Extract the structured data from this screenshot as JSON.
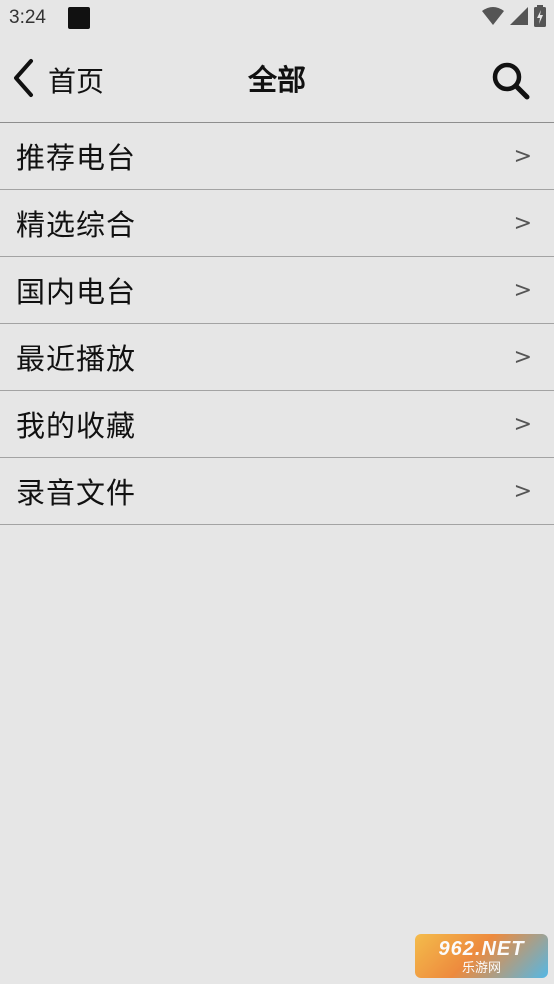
{
  "status_bar": {
    "time": "3:24",
    "icons": [
      "wifi-icon",
      "signal-icon",
      "battery-icon"
    ]
  },
  "nav": {
    "back_label": "首页",
    "title": "全部",
    "search_icon": "search-icon"
  },
  "menu": {
    "items": [
      {
        "label": "推荐电台",
        "arrow": ">"
      },
      {
        "label": "精选综合",
        "arrow": ">"
      },
      {
        "label": "国内电台",
        "arrow": ">"
      },
      {
        "label": "最近播放",
        "arrow": ">"
      },
      {
        "label": "我的收藏",
        "arrow": ">"
      },
      {
        "label": "录音文件",
        "arrow": ">"
      }
    ]
  },
  "watermark": {
    "top": "962.NET",
    "bottom": "乐游网"
  },
  "colors": {
    "background": "#e6e6e6",
    "divider": "#a3a3a3",
    "text": "#111111",
    "arrow": "#555555"
  }
}
